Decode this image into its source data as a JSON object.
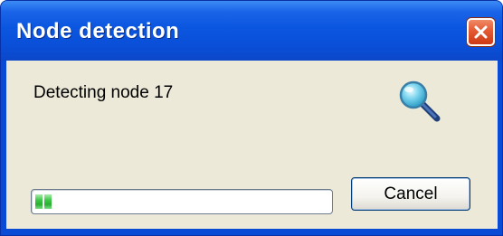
{
  "window": {
    "title": "Node detection",
    "close_icon": "close-icon"
  },
  "dialog": {
    "message": "Detecting node 17",
    "status_icon": "search-icon",
    "progress_percent": 6,
    "cancel_label": "Cancel"
  },
  "colors": {
    "title_bar": "#0a4fd8",
    "client_background": "#ece9d8",
    "close_button": "#e35a32",
    "progress_fill": "#3cc646"
  }
}
